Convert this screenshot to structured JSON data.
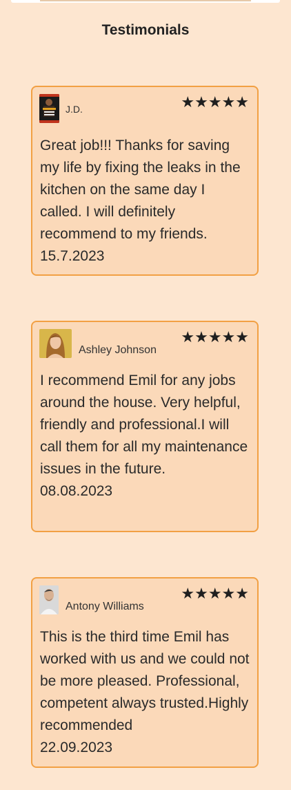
{
  "page": {
    "title": "Testimonials"
  },
  "colors": {
    "background": "#fde6d0",
    "card_background": "#fbd9b9",
    "card_border": "#f2a043",
    "stars": "#1f1f1f"
  },
  "testimonials": [
    {
      "name": "J.D.",
      "avatar_icon": "book-cover-avatar",
      "rating": 5,
      "stars": "★★★★★",
      "text": "Great job!!! Thanks for saving my life by fixing the leaks in the kitchen on the same day I called. I will definitely recommend to my friends.",
      "date": "15.7.2023"
    },
    {
      "name": "Ashley Johnson",
      "avatar_icon": "woman-portrait-avatar",
      "rating": 5,
      "stars": "★★★★★",
      "text": "I recommend Emil for any jobs around the house. Very helpful, friendly and professional.I will call them for all my maintenance issues in the future.",
      "date": "08.08.2023"
    },
    {
      "name": "Antony Williams",
      "avatar_icon": "man-portrait-avatar",
      "rating": 5,
      "stars": "★★★★★",
      "text": "This is the third time Emil has worked with us and we could not be more pleased. Professional, competent always trusted.Highly recommended",
      "date": "22.09.2023"
    }
  ]
}
